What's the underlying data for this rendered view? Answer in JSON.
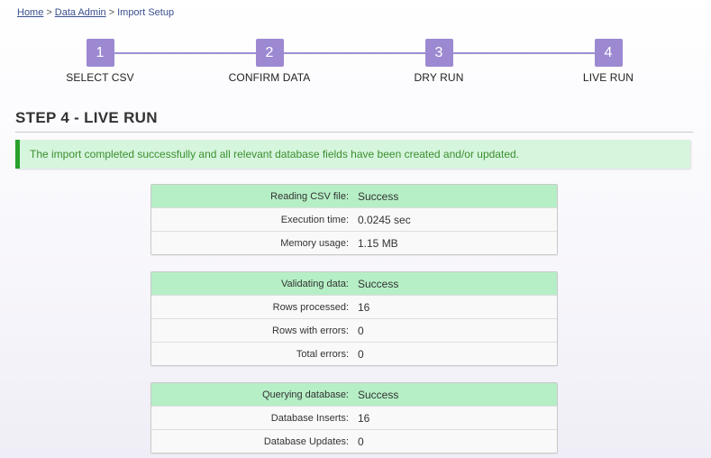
{
  "breadcrumb": {
    "home": "Home",
    "data_admin": "Data Admin",
    "current": "Import Setup",
    "separator": ">"
  },
  "stepper": {
    "steps": [
      {
        "number": "1",
        "label": "SELECT CSV"
      },
      {
        "number": "2",
        "label": "CONFIRM DATA"
      },
      {
        "number": "3",
        "label": "DRY RUN"
      },
      {
        "number": "4",
        "label": "LIVE RUN"
      }
    ],
    "color": "#9c89d1"
  },
  "page": {
    "title": "STEP 4 - LIVE RUN"
  },
  "alert": {
    "message": "The import completed successfully and all relevant database fields have been created and/or updated.",
    "color": "#3b8f2f"
  },
  "panels": {
    "csv": {
      "head": {
        "label": "Reading CSV file:",
        "value": "Success"
      },
      "rows": [
        {
          "label": "Execution time:",
          "value": "0.0245 sec"
        },
        {
          "label": "Memory usage:",
          "value": "1.15 MB"
        }
      ]
    },
    "validate": {
      "head": {
        "label": "Validating data:",
        "value": "Success"
      },
      "rows": [
        {
          "label": "Rows processed:",
          "value": "16"
        },
        {
          "label": "Rows with errors:",
          "value": "0"
        },
        {
          "label": "Total errors:",
          "value": "0"
        }
      ]
    },
    "database": {
      "head": {
        "label": "Querying database:",
        "value": "Success"
      },
      "rows": [
        {
          "label": "Database Inserts:",
          "value": "16"
        },
        {
          "label": "Database Updates:",
          "value": "0"
        }
      ]
    }
  }
}
